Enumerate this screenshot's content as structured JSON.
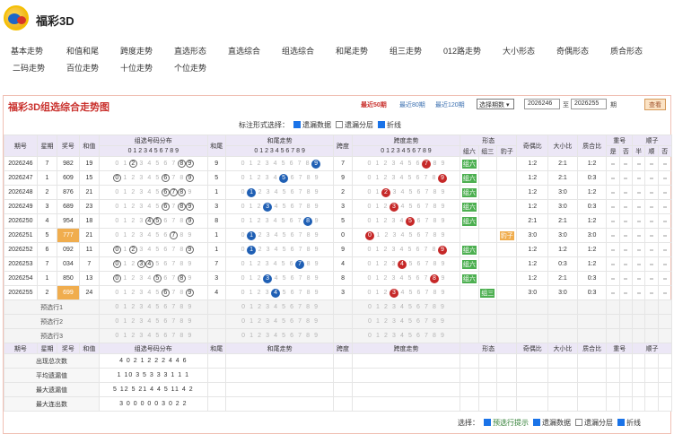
{
  "app": {
    "title": "福彩3D"
  },
  "nav": [
    "基本走势",
    "和值和尾",
    "跨度走势",
    "直选形态",
    "直选综合",
    "组选综合",
    "和尾走势",
    "组三走势",
    "012路走势",
    "大小形态",
    "奇偶形态",
    "质合形态",
    "二码走势",
    "百位走势",
    "十位走势",
    "个位走势"
  ],
  "panel": {
    "title": "福彩3D组选综合走势图",
    "range_links": [
      "最近50期",
      "最近80期",
      "最近120期"
    ],
    "select_value": "选择期数",
    "from": "2026246",
    "to_label": "至",
    "to": "2026255",
    "qi_label": "期",
    "query_btn": "查看"
  },
  "options": {
    "label": "标注形式选择：",
    "items": [
      "遗漏数据",
      "遗漏分层",
      "折线"
    ]
  },
  "headers": {
    "qihao": "期号",
    "xingqi": "星期",
    "jianghao": "奖号",
    "hezhi": "和值",
    "zuxuan": "组选号码分布",
    "hewei": "和尾",
    "hewei_trend": "和尾走势",
    "kuadu": "跨度",
    "kuadu_trend": "跨度走势",
    "xingtai": "形态",
    "zu6": "组六",
    "zu3": "组三",
    "baozi": "豹子",
    "jiou": "奇偶比",
    "daxiao": "大小比",
    "zhihe": "质合比",
    "chonghao": "重号",
    "chonghao_sub": [
      "是",
      "否"
    ],
    "shunzi": "顺子",
    "shunzi_sub": [
      "半",
      "顺",
      "否"
    ]
  },
  "rows": [
    {
      "qi": "2026246",
      "xq": "7",
      "num": "982",
      "sum": "19",
      "hw": "9",
      "kd": "7",
      "xt": "组六",
      "jo": "1:2",
      "dx": "2:1",
      "zh": "1:2"
    },
    {
      "qi": "2026247",
      "xq": "1",
      "num": "609",
      "sum": "15",
      "hw": "5",
      "kd": "9",
      "xt": "组六",
      "jo": "1:2",
      "dx": "2:1",
      "zh": "0:3"
    },
    {
      "qi": "2026248",
      "xq": "2",
      "num": "876",
      "sum": "21",
      "hw": "1",
      "kd": "2",
      "xt": "组六",
      "jo": "1:2",
      "dx": "3:0",
      "zh": "1:2"
    },
    {
      "qi": "2026249",
      "xq": "3",
      "num": "689",
      "sum": "23",
      "hw": "3",
      "kd": "3",
      "xt": "组六",
      "jo": "1:2",
      "dx": "3:0",
      "zh": "0:3"
    },
    {
      "qi": "2026250",
      "xq": "4",
      "num": "954",
      "sum": "18",
      "hw": "8",
      "kd": "5",
      "xt": "组六",
      "jo": "2:1",
      "dx": "2:1",
      "zh": "1:2"
    },
    {
      "qi": "2026251",
      "xq": "5",
      "num": "777",
      "sum": "21",
      "hw": "1",
      "kd": "0",
      "xt": "豹子",
      "jo": "3:0",
      "dx": "3:0",
      "zh": "3:0"
    },
    {
      "qi": "2026252",
      "xq": "6",
      "num": "092",
      "sum": "11",
      "hw": "1",
      "kd": "9",
      "xt": "组六",
      "jo": "1:2",
      "dx": "1:2",
      "zh": "1:2"
    },
    {
      "qi": "2026253",
      "xq": "7",
      "num": "034",
      "sum": "7",
      "hw": "7",
      "kd": "4",
      "xt": "组六",
      "jo": "1:2",
      "dx": "0:3",
      "zh": "1:2"
    },
    {
      "qi": "2026254",
      "xq": "1",
      "num": "850",
      "sum": "13",
      "hw": "3",
      "kd": "8",
      "xt": "组六",
      "jo": "1:2",
      "dx": "2:1",
      "zh": "0:3"
    },
    {
      "qi": "2026255",
      "xq": "2",
      "num": "699",
      "sum": "24",
      "hw": "4",
      "kd": "3",
      "xt": "组三",
      "jo": "3:0",
      "dx": "3:0",
      "zh": "0:3"
    }
  ],
  "preselect": [
    "预选行1",
    "预选行2",
    "预选行3"
  ],
  "stats": [
    {
      "label": "出现总次数",
      "zx": "4 0 2 1 2 2 2 4 4 6"
    },
    {
      "label": "平均遗漏值",
      "zx": "1 10 3 5 3 3 3 1 1 1"
    },
    {
      "label": "最大遗漏值",
      "zx": "5 12 5 21 4 4 5 11 4 2"
    },
    {
      "label": "最大连出数",
      "zx": "3 0 0 0 0 0 3 0 2 2"
    }
  ],
  "bottom": {
    "label": "选择：",
    "items": [
      "预选行提示",
      "遗漏数据",
      "遗漏分层",
      "折线"
    ]
  }
}
